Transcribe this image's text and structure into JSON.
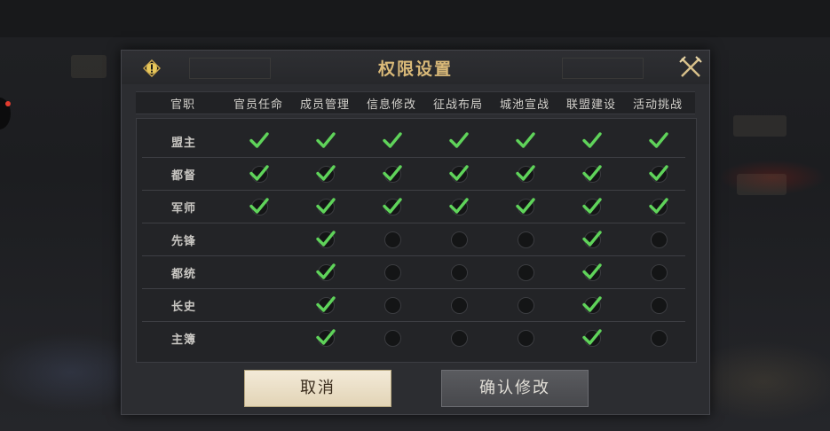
{
  "dialog": {
    "title": "权限设置",
    "cancel_label": "取消",
    "confirm_label": "确认修改",
    "icons": {
      "warning": "exclamation-icon",
      "close": "crossed-swords-close-icon"
    }
  },
  "table": {
    "rank_header": "官职",
    "permission_headers": [
      "官员任命",
      "成员管理",
      "信息修改",
      "征战布局",
      "城池宣战",
      "联盟建设",
      "活动挑战"
    ],
    "rows": [
      {
        "rank": "盟主",
        "perms": [
          true,
          true,
          true,
          true,
          true,
          true,
          true
        ]
      },
      {
        "rank": "都督",
        "perms": [
          true,
          true,
          true,
          true,
          true,
          true,
          true
        ]
      },
      {
        "rank": "军师",
        "perms": [
          true,
          true,
          true,
          true,
          true,
          true,
          true
        ]
      },
      {
        "rank": "先锋",
        "perms": [
          null,
          true,
          false,
          false,
          false,
          true,
          false
        ]
      },
      {
        "rank": "都统",
        "perms": [
          null,
          true,
          false,
          false,
          false,
          true,
          false
        ]
      },
      {
        "rank": "长史",
        "perms": [
          null,
          true,
          false,
          false,
          false,
          true,
          false
        ]
      },
      {
        "rank": "主簿",
        "perms": [
          null,
          true,
          false,
          false,
          false,
          true,
          false
        ]
      }
    ]
  },
  "colors": {
    "check_green": "#5fd35a",
    "title_gold": "#d9b978"
  }
}
